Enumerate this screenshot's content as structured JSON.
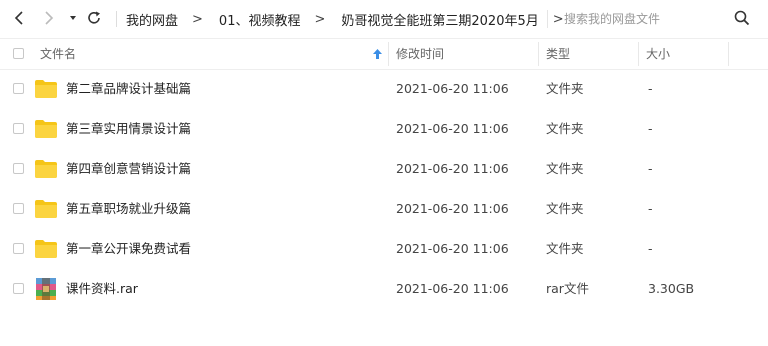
{
  "breadcrumb": [
    "我的网盘",
    "01、视频教程",
    "奶哥视觉全能班第三期2020年5月"
  ],
  "breadcrumb_separator": ">",
  "search": {
    "placeholder": "搜索我的网盘文件"
  },
  "columns": {
    "name": "文件名",
    "modified": "修改时间",
    "type": "类型",
    "size": "大小"
  },
  "sort_indicator": "ascending",
  "files": [
    {
      "name": "第二章品牌设计基础篇",
      "modified": "2021-06-20 11:06",
      "type": "文件夹",
      "size": "-",
      "icon": "folder-icon"
    },
    {
      "name": "第三章实用情景设计篇",
      "modified": "2021-06-20 11:06",
      "type": "文件夹",
      "size": "-",
      "icon": "folder-icon"
    },
    {
      "name": "第四章创意营销设计篇",
      "modified": "2021-06-20 11:06",
      "type": "文件夹",
      "size": "-",
      "icon": "folder-icon"
    },
    {
      "name": "第五章职场就业升级篇",
      "modified": "2021-06-20 11:06",
      "type": "文件夹",
      "size": "-",
      "icon": "folder-icon"
    },
    {
      "name": "第一章公开课免费试看",
      "modified": "2021-06-20 11:06",
      "type": "文件夹",
      "size": "-",
      "icon": "folder-icon"
    },
    {
      "name": "课件资料.rar",
      "modified": "2021-06-20 11:06",
      "type": "rar文件",
      "size": "3.30GB",
      "icon": "rar-archive-icon"
    }
  ],
  "colors": {
    "folder": "#f5c518",
    "accent": "#3b8ee6",
    "text": "#222222",
    "muted": "#999999"
  }
}
